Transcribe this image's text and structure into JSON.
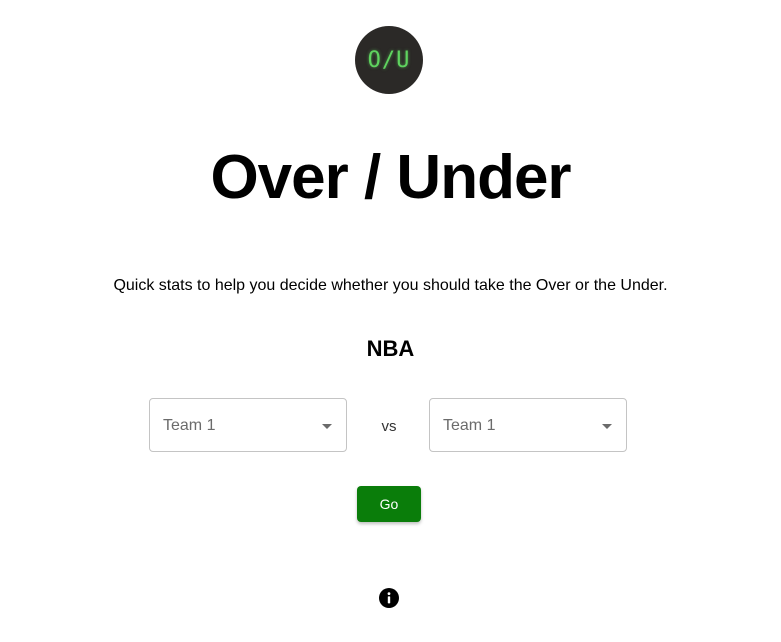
{
  "logo": {
    "text": "O/U",
    "background_color": "#2b2927",
    "text_color": "#5fd35f"
  },
  "header": {
    "title": "Over / Under",
    "tagline": "Quick stats to help you decide whether you should take the Over or the Under."
  },
  "league": {
    "name": "NBA"
  },
  "matchup": {
    "team_left": {
      "value": "Team 1"
    },
    "separator": "vs",
    "team_right": {
      "value": "Team 1"
    }
  },
  "actions": {
    "go_label": "Go",
    "go_color": "#0a7d0a"
  },
  "footer": {
    "info_icon": "info-icon"
  }
}
